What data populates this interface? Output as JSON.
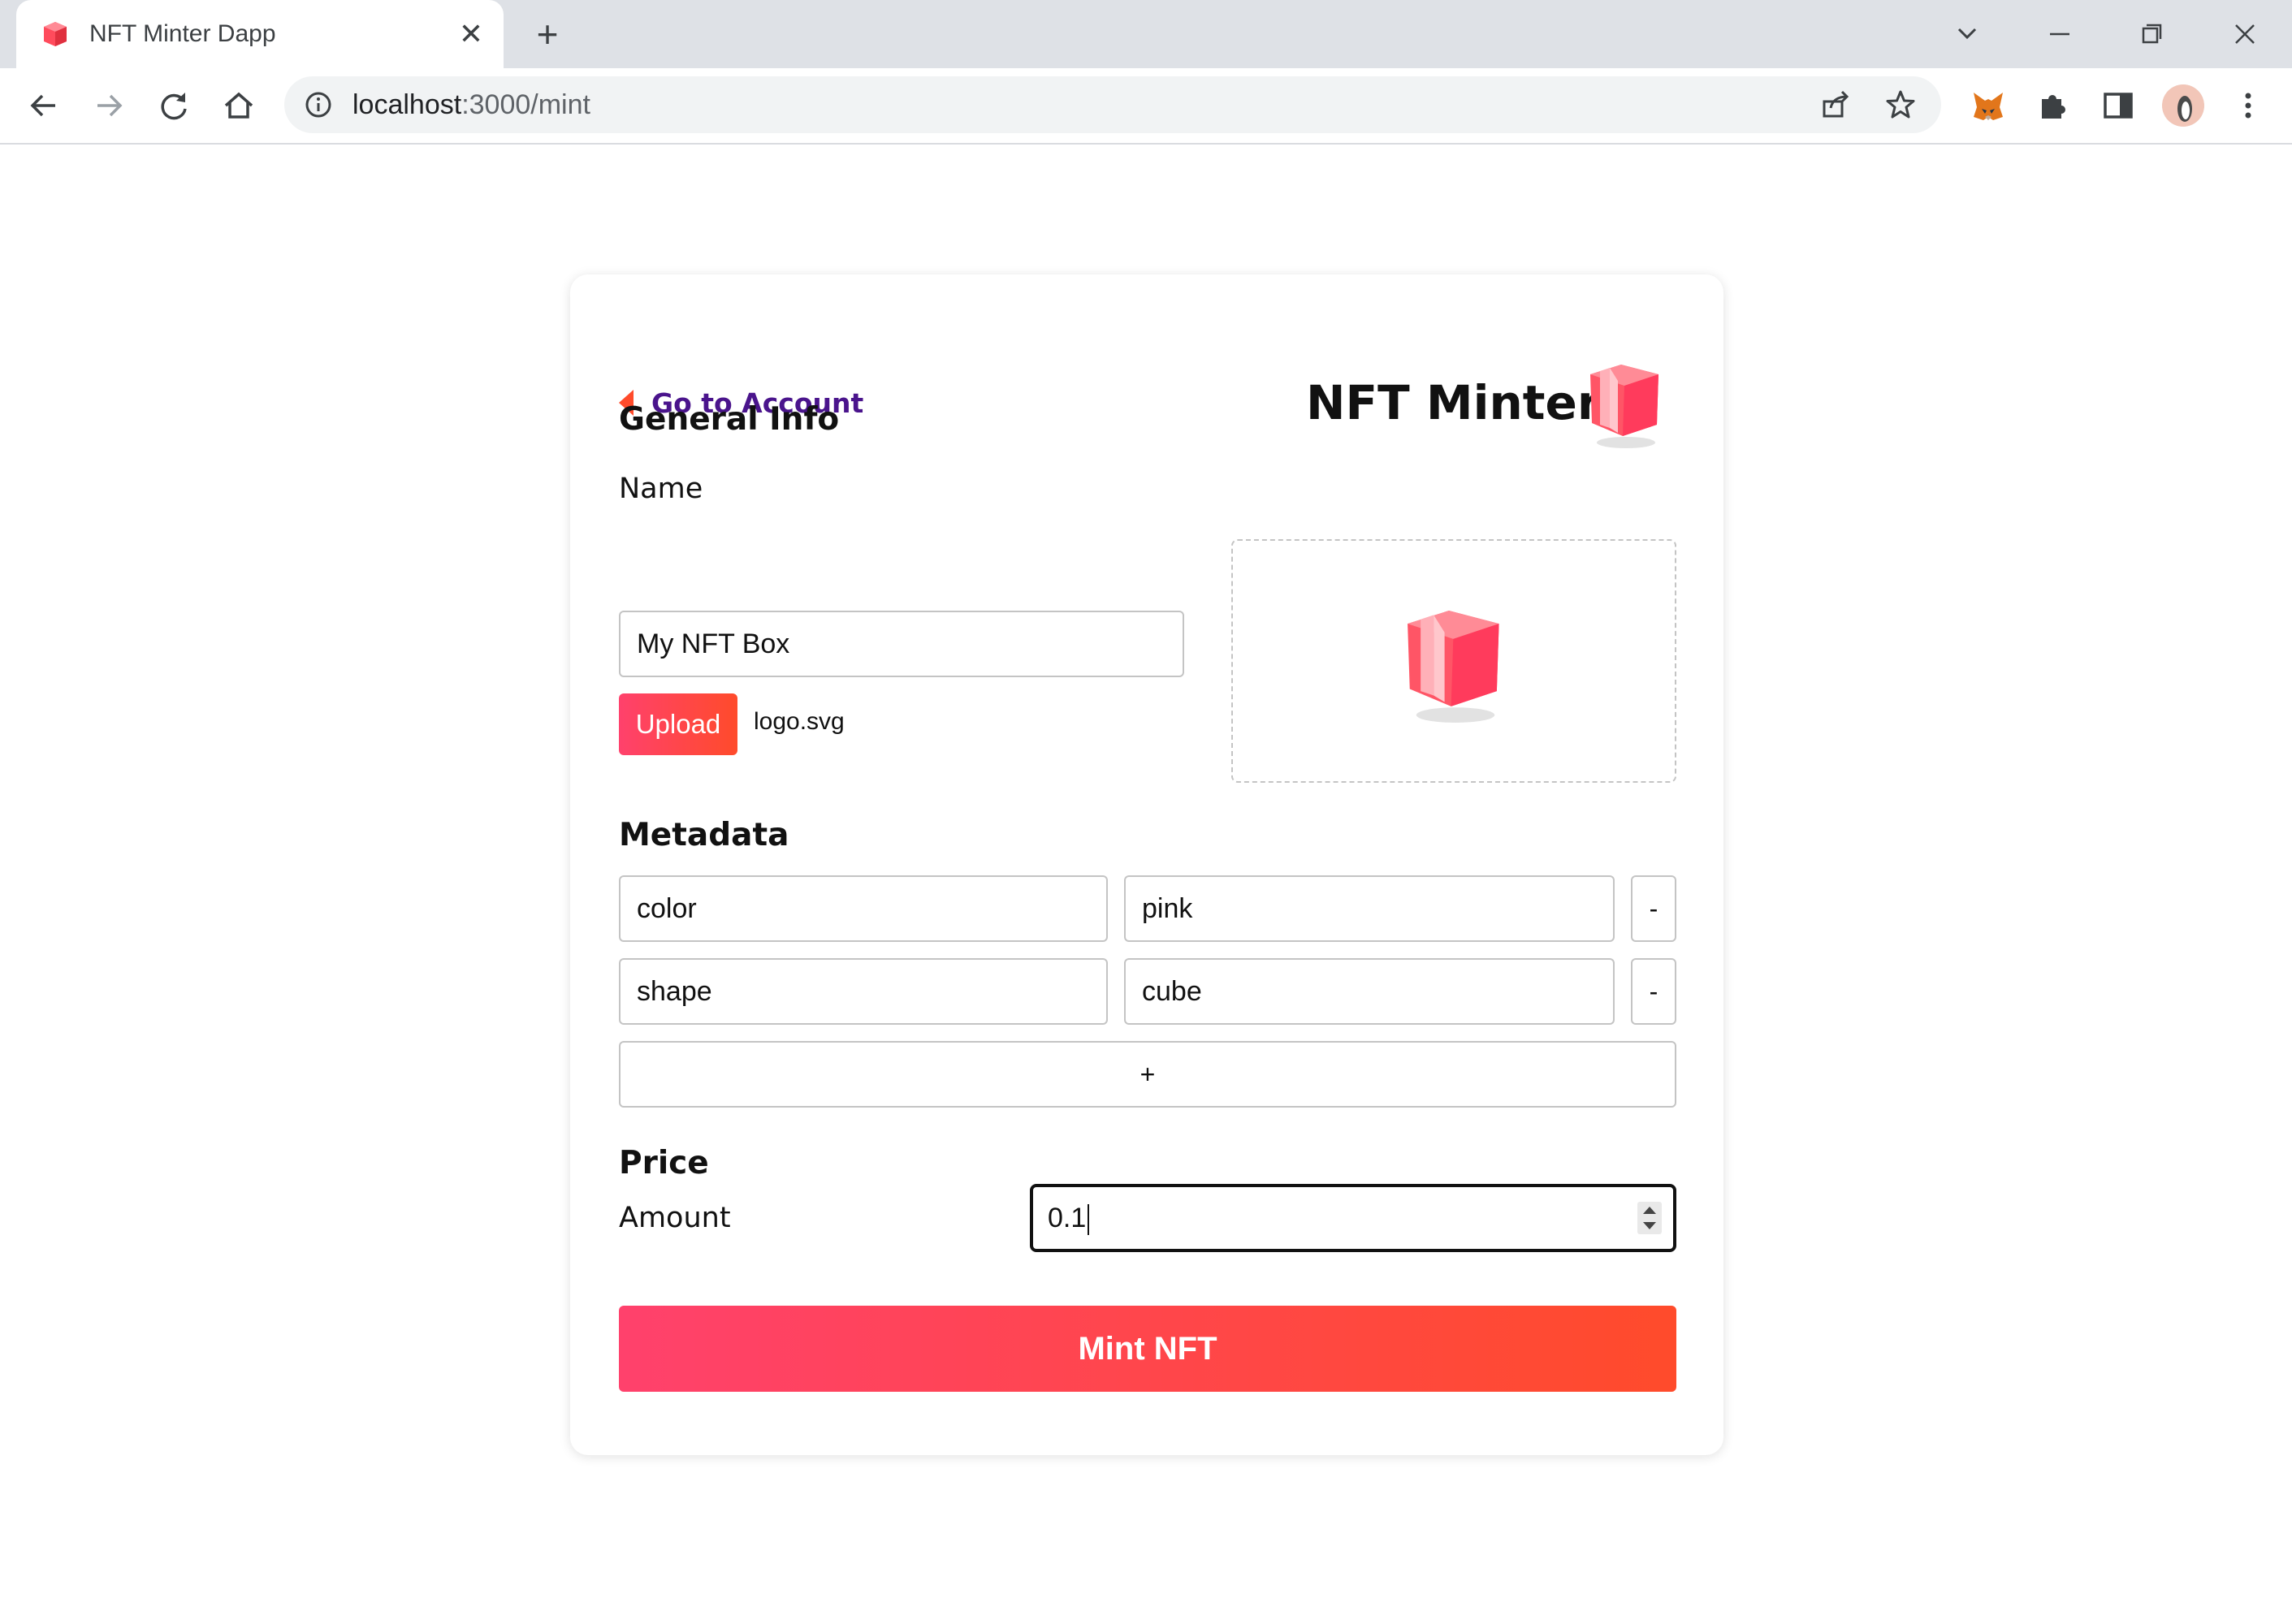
{
  "browser": {
    "tab_title": "NFT Minter Dapp",
    "url_host": "localhost",
    "url_path": ":3000/mint"
  },
  "page": {
    "back_link": "Go to Account",
    "app_title": "NFT Minter",
    "general_info": {
      "heading": "General Info",
      "name_label": "Name",
      "name_value": "My NFT Box",
      "upload_button": "Upload",
      "file_name": "logo.svg"
    },
    "metadata": {
      "heading": "Metadata",
      "rows": [
        {
          "key": "color",
          "value": "pink",
          "remove": "-"
        },
        {
          "key": "shape",
          "value": "cube",
          "remove": "-"
        }
      ],
      "add_button": "+"
    },
    "price": {
      "heading": "Price",
      "amount_label": "Amount",
      "amount_value": "0.1"
    },
    "mint_button": "Mint NFT"
  },
  "colors": {
    "accent_start": "#ff416c",
    "accent_end": "#ff4b2b",
    "link": "#4a148c"
  }
}
